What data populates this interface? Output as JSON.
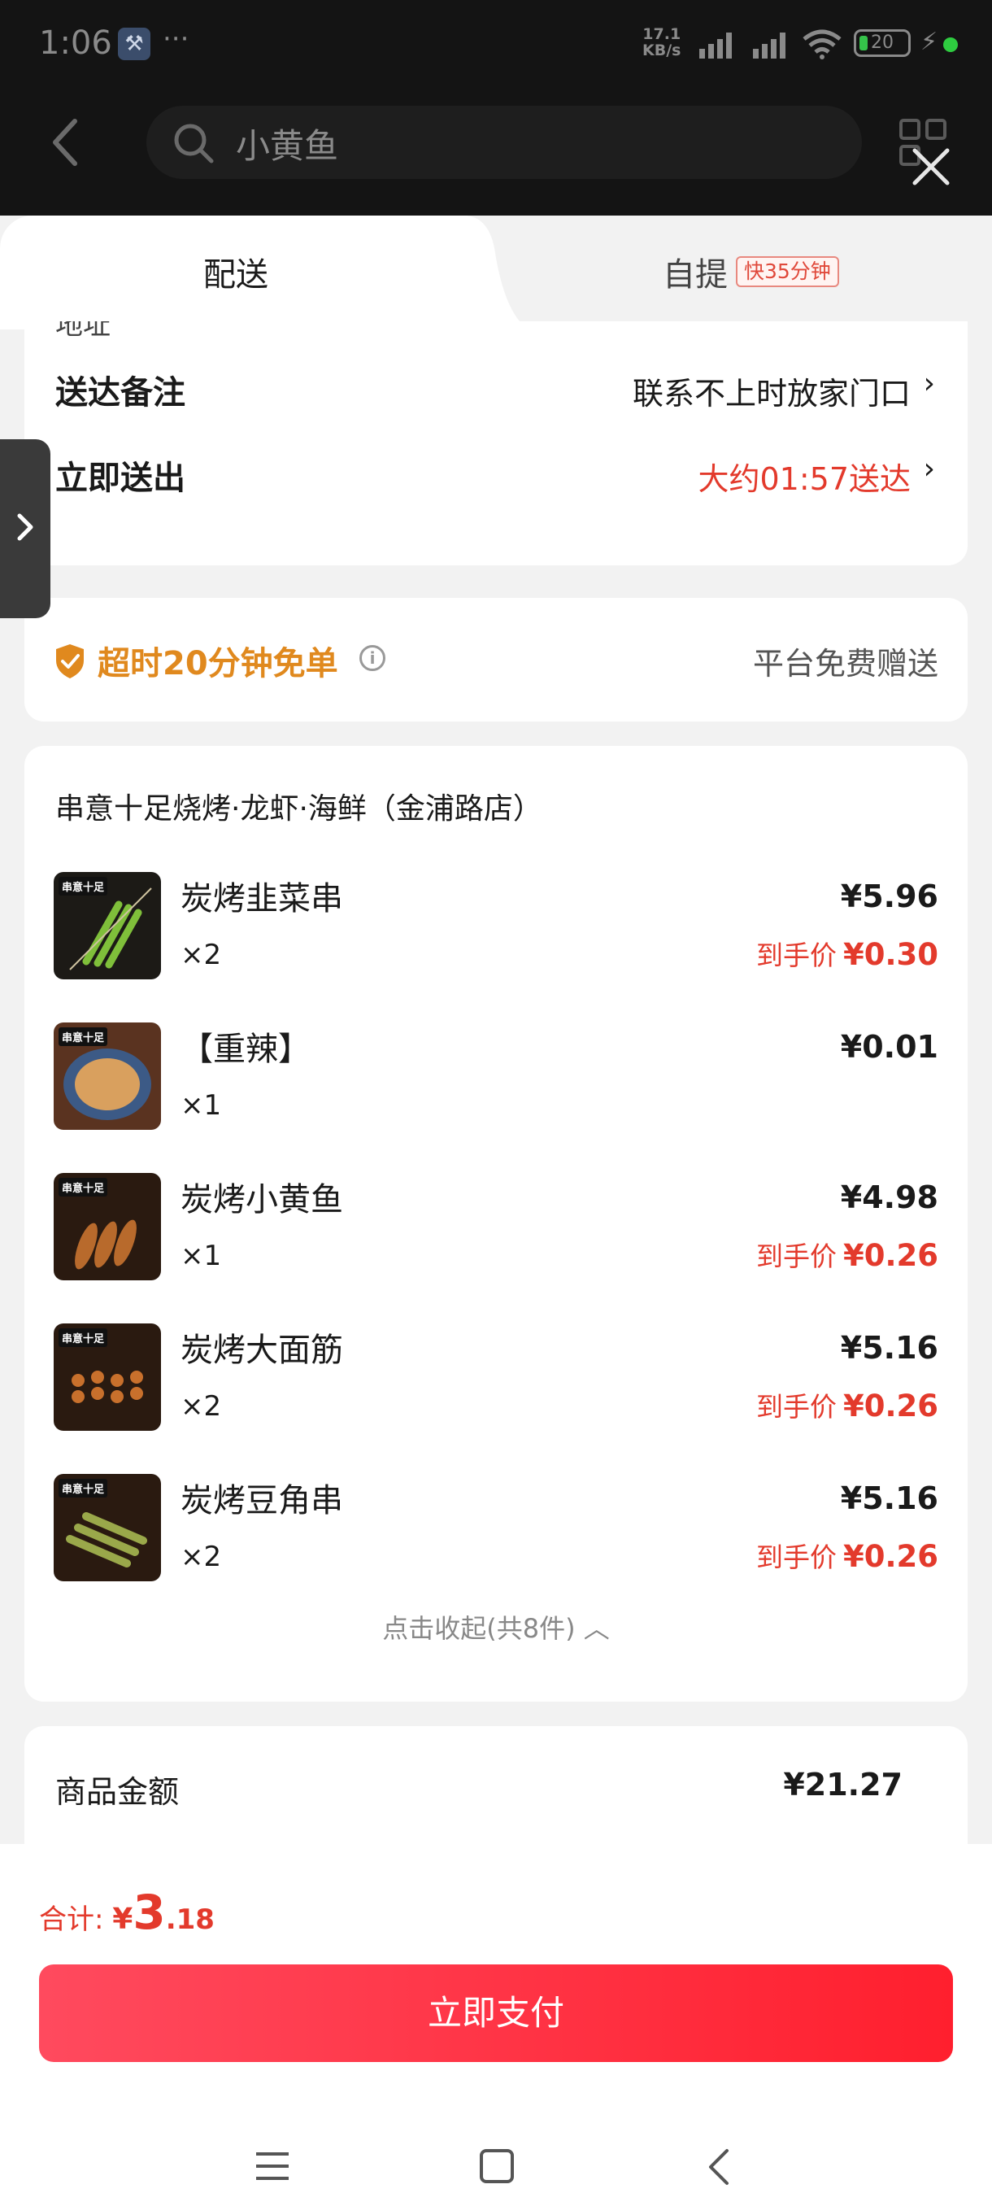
{
  "status_bar": {
    "time": "1:06",
    "dots": "···",
    "speed_top": "17.1",
    "speed_bottom": "KB/s",
    "battery": "20"
  },
  "search": {
    "query": "小黄鱼"
  },
  "tabs": {
    "delivery": "配送",
    "pickup": "自提",
    "pickup_badge": "快35分钟"
  },
  "delivery": {
    "cut_text": "地址",
    "note_label": "送达备注",
    "note_value": "联系不上时放家门口",
    "send_label": "立即送出",
    "send_value": "大约01:57送达"
  },
  "guarantee": {
    "text": "超时20分钟免单",
    "info": "i",
    "right": "平台免费赠送"
  },
  "store": {
    "name": "串意十足烧烤·龙虾·海鲜（金浦路店）",
    "logo": "串意十足"
  },
  "final_label": "到手价",
  "items": [
    {
      "name": "炭烤韭菜串",
      "qty": "×2",
      "price": "¥5.96",
      "final": "¥0.30"
    },
    {
      "name": "【重辣】",
      "qty": "×1",
      "price": "¥0.01",
      "final": ""
    },
    {
      "name": "炭烤小黄鱼",
      "qty": "×1",
      "price": "¥4.98",
      "final": "¥0.26"
    },
    {
      "name": "炭烤大面筋",
      "qty": "×2",
      "price": "¥5.16",
      "final": "¥0.26"
    },
    {
      "name": "炭烤豆角串",
      "qty": "×2",
      "price": "¥5.16",
      "final": "¥0.26"
    }
  ],
  "collapse": "点击收起(共8件) ︿",
  "amount": {
    "label": "商品金额",
    "value": "¥21.27"
  },
  "footer": {
    "total_label": "合计: ",
    "yen": "¥",
    "total_int": "3",
    "total_dec": ".18",
    "pay": "立即支付"
  }
}
